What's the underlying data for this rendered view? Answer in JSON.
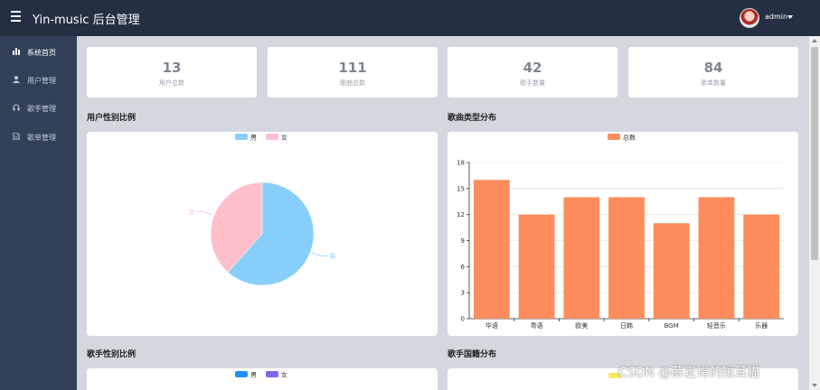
{
  "header": {
    "title": "Yin-music 后台管理",
    "user_name": "admin"
  },
  "sidebar": {
    "items": [
      {
        "label": "系统首页",
        "icon": "bar-chart-icon"
      },
      {
        "label": "用户管理",
        "icon": "user-icon"
      },
      {
        "label": "歌手管理",
        "icon": "headphones-icon"
      },
      {
        "label": "歌单管理",
        "icon": "document-icon"
      }
    ]
  },
  "stats": [
    {
      "value": "13",
      "label": "用户总数"
    },
    {
      "value": "111",
      "label": "歌曲总数"
    },
    {
      "value": "42",
      "label": "歌手数量"
    },
    {
      "value": "84",
      "label": "歌单数量"
    }
  ],
  "sections": {
    "user_gender": "用户性别比例",
    "song_type": "歌曲类型分布",
    "singer_gender": "歌手性别比例",
    "singer_country": "歌手国籍分布"
  },
  "colors": {
    "male": "#87cefa",
    "female": "#ffc0cb",
    "bar": "#ff8c5c",
    "singer_male": "#1e90ff",
    "singer_female": "#7b68ee",
    "topbar": "#242f42",
    "sidebar": "#324157"
  },
  "watermark": "CSDN @薛定谔的短耳猫",
  "chart_data": [
    {
      "type": "pie",
      "legend": [
        "男",
        "女"
      ],
      "labels": [
        "男",
        "女"
      ],
      "values": [
        8,
        5
      ],
      "colors": [
        "#87cefa",
        "#ffc0cb"
      ],
      "legend_position": "top-center"
    },
    {
      "type": "bar",
      "legend": [
        "总数"
      ],
      "series": [
        {
          "name": "总数",
          "values": [
            16,
            12,
            14,
            14,
            11,
            14,
            12
          ]
        }
      ],
      "categories": [
        "华语",
        "粤语",
        "欧美",
        "日韩",
        "BGM",
        "轻音乐",
        "乐器"
      ],
      "ylim": [
        0,
        18
      ],
      "yticks": [
        0,
        3,
        6,
        9,
        12,
        15,
        18
      ],
      "grid": true,
      "legend_position": "top-center"
    },
    {
      "type": "pie",
      "legend": [
        "男",
        "女"
      ],
      "colors": [
        "#1e90ff",
        "#7b68ee"
      ],
      "legend_position": "top-center"
    }
  ]
}
